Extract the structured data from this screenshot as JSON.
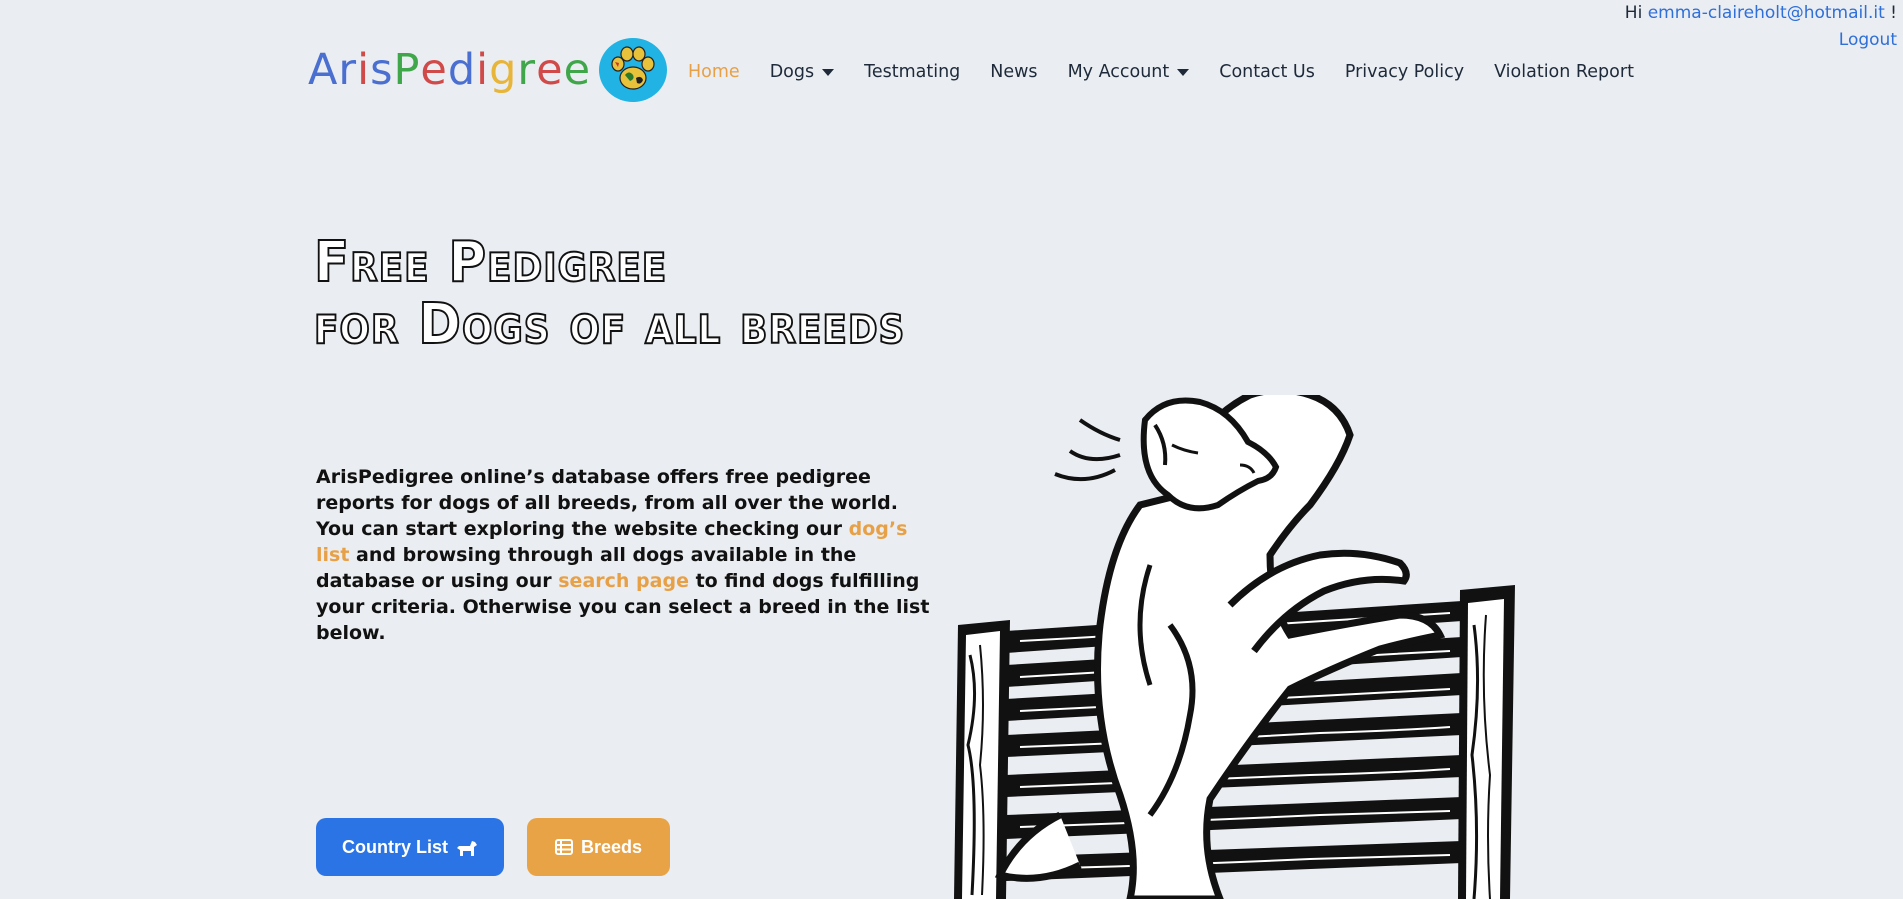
{
  "user": {
    "greeting": "Hi",
    "email": "emma-claireholt@hotmail.it",
    "suffix": "!",
    "logout_label": "Logout"
  },
  "logo": {
    "letters": [
      {
        "ch": "A",
        "color": "#4a6fd0"
      },
      {
        "ch": "r",
        "color": "#4a6fd0"
      },
      {
        "ch": "i",
        "color": "#d04a4a"
      },
      {
        "ch": "s",
        "color": "#4a6fd0"
      },
      {
        "ch": "P",
        "color": "#3fa64a"
      },
      {
        "ch": "e",
        "color": "#d04a4a"
      },
      {
        "ch": "d",
        "color": "#4a6fd0"
      },
      {
        "ch": "i",
        "color": "#d04a4a"
      },
      {
        "ch": "g",
        "color": "#e8b53b"
      },
      {
        "ch": "r",
        "color": "#3fa64a"
      },
      {
        "ch": "e",
        "color": "#d04a4a"
      },
      {
        "ch": "e",
        "color": "#3fa64a"
      }
    ],
    "badge_icon": "paw-globe-icon"
  },
  "nav": {
    "home": "Home",
    "dogs": "Dogs",
    "testmating": "Testmating",
    "news": "News",
    "my_account": "My Account",
    "contact": "Contact Us",
    "privacy": "Privacy Policy",
    "violation": "Violation Report"
  },
  "hero": {
    "line1": "Free Pedigree",
    "line2": "for Dogs of all breeds"
  },
  "description": {
    "part1": "ArisPedigree online’s database offers free pedigree reports for dogs of all breeds, from all over the world. You can start exploring the website checking our ",
    "link1": "dog’s list",
    "part2": " and browsing through all dogs available in the database or using our ",
    "link2": "search page",
    "part3": " to find dogs fulfilling your criteria. Otherwise you can select a breed in the list below."
  },
  "buttons": {
    "country_list": "Country List",
    "breeds": "Breeds"
  },
  "colors": {
    "accent_orange": "#e8a046",
    "primary_blue": "#2b74e6",
    "background": "#eaedf1"
  }
}
